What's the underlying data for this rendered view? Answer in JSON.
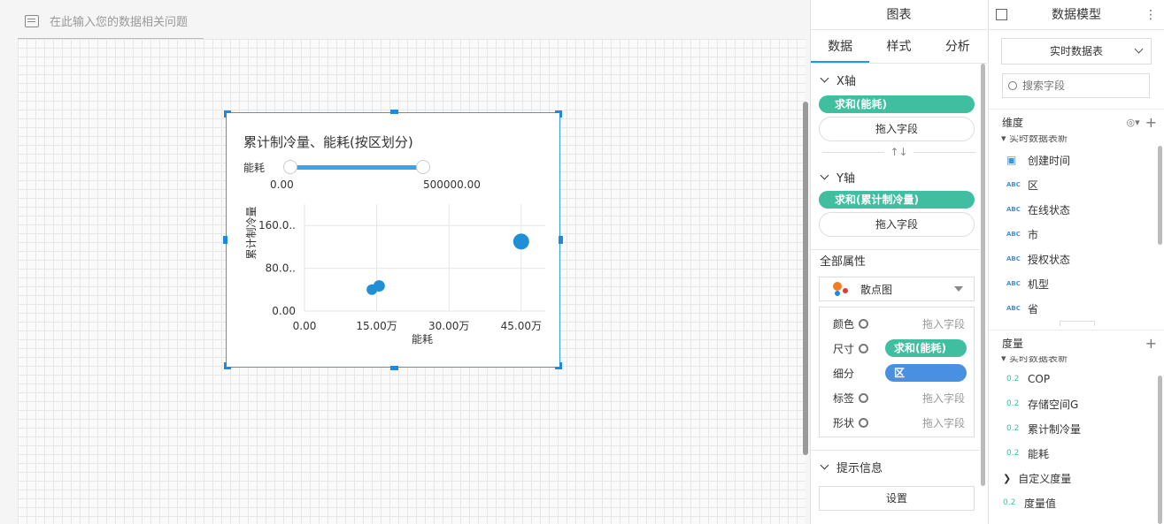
{
  "question_bar": {
    "placeholder": "在此输入您的数据相关问题"
  },
  "widget": {
    "title": "累计制冷量、能耗(按区划分)",
    "slider": {
      "label": "能耗",
      "min_label": "0.00",
      "max_label": "500000.00"
    }
  },
  "chart_data": {
    "type": "scatter",
    "title": "累计制冷量、能耗(按区划分)",
    "xlabel": "能耗",
    "ylabel": "累计制冷量",
    "xlim": [
      0,
      500000
    ],
    "ylim": [
      0,
      200
    ],
    "x_ticks": [
      {
        "v": 0,
        "label": "0.00"
      },
      {
        "v": 150000,
        "label": "15.00万"
      },
      {
        "v": 300000,
        "label": "30.00万"
      },
      {
        "v": 450000,
        "label": "45.00万"
      }
    ],
    "y_ticks": [
      {
        "v": 0,
        "label": "0.00"
      },
      {
        "v": 80,
        "label": "80.0.."
      },
      {
        "v": 160,
        "label": "160.0.."
      }
    ],
    "points": [
      {
        "x": 140000,
        "y": 40,
        "size": 6
      },
      {
        "x": 155000,
        "y": 47,
        "size": 6.5
      },
      {
        "x": 450000,
        "y": 130,
        "size": 9
      }
    ],
    "color": "#1f8fd6",
    "grid": true
  },
  "chart_panel": {
    "title": "图表",
    "tabs": [
      "数据",
      "样式",
      "分析"
    ],
    "x_axis": {
      "label": "X轴",
      "field": "求和(能耗)",
      "drop": "拖入字段"
    },
    "y_axis": {
      "label": "Y轴",
      "field": "求和(累计制冷量)",
      "drop": "拖入字段"
    },
    "swap_icon": "↑↓",
    "all_props": {
      "label": "全部属性",
      "chart_type": "散点图"
    },
    "props": [
      {
        "label": "颜色",
        "value": "拖入字段"
      },
      {
        "label": "尺寸",
        "value": "求和(能耗)",
        "color": "#3fbfa0"
      },
      {
        "label": "细分",
        "value": "区",
        "color": "#4a90e2"
      },
      {
        "label": "标签",
        "value": "拖入字段"
      },
      {
        "label": "形状",
        "value": "拖入字段"
      }
    ],
    "tooltip": {
      "label": "提示信息",
      "button": "设置"
    }
  },
  "model_panel": {
    "title": "数据模型",
    "table_select": "实时数据表",
    "search_placeholder": "搜索字段",
    "dim_label": "维度",
    "dim_group": "实时数据表新",
    "dimensions": [
      {
        "type": "date",
        "name": "创建时间"
      },
      {
        "type": "ABC",
        "name": "区"
      },
      {
        "type": "ABC",
        "name": "在线状态"
      },
      {
        "type": "ABC",
        "name": "市"
      },
      {
        "type": "ABC",
        "name": "授权状态"
      },
      {
        "type": "ABC",
        "name": "机型"
      },
      {
        "type": "ABC",
        "name": "省"
      }
    ],
    "measure_label": "度量",
    "measure_group": "实时数据表新",
    "measures": [
      {
        "type": "0.2",
        "name": "COP"
      },
      {
        "type": "0.2",
        "name": "存储空间G"
      },
      {
        "type": "0.2",
        "name": "累计制冷量"
      },
      {
        "type": "0.2",
        "name": "能耗"
      }
    ],
    "custom_measure": "自定义度量",
    "measure_value": "度量值",
    "measure_value_type": "0.2"
  }
}
